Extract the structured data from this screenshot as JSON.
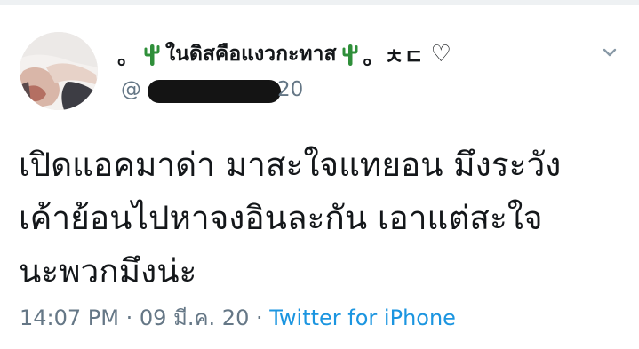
{
  "tweet": {
    "display_name": "ในดิสคือแงวกะทาส",
    "name_prefix": "。",
    "name_suffix": "。ㅊㄷ",
    "name_heart": "♡",
    "handle_prefix": "@",
    "handle_visible_tail": "20",
    "body": "เปิดแอคมาด่า มาสะใจแทยอน มึงระวัง\nเค้าย้อนไปหาจงอินละกัน เอาแต่สะใจ\nนะพวกมึงน่ะ",
    "time": "14:07 PM",
    "separator": " · ",
    "date": "09 มี.ค. 20",
    "source": "Twitter for iPhone"
  },
  "icons": {
    "cactus": "cactus-icon",
    "menu": "chevron-down-icon"
  },
  "colors": {
    "text": "#14171a",
    "secondary": "#657786",
    "link": "#1b95e0",
    "cactus": "#2f8f3a"
  }
}
